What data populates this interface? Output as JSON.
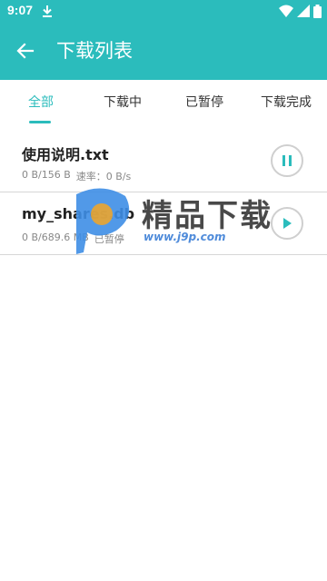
{
  "status_bar": {
    "time": "9:07",
    "icons": [
      "download-icon",
      "wifi-icon",
      "signal-icon",
      "battery-icon"
    ]
  },
  "app_bar": {
    "back_icon": "arrow-left-icon",
    "title": "下载列表"
  },
  "tabs": [
    {
      "label": "全部",
      "active": true
    },
    {
      "label": "下载中",
      "active": false
    },
    {
      "label": "已暂停",
      "active": false
    },
    {
      "label": "下载完成",
      "active": false
    }
  ],
  "downloads": [
    {
      "name": "使用说明.txt",
      "size": "0 B/156 B",
      "status": "速率：0 B/s",
      "action_icon": "pause-icon"
    },
    {
      "name": "my_shares.db",
      "size": "0 B/689.6 MB",
      "status": "已暂停",
      "action_icon": "play-icon"
    }
  ],
  "watermark": {
    "title": "精品下载",
    "url": "www.j9p.com"
  },
  "colors": {
    "primary": "#2bbcbc",
    "text_dark": "#222222",
    "text_meta": "#888888",
    "divider": "#d6d6d6"
  }
}
